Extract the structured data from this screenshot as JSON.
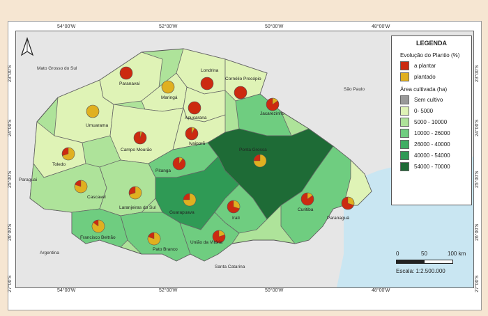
{
  "colors": {
    "a_plantar": "#cc2a10",
    "plantado": "#e0b020",
    "sem_cultivo": "#999999",
    "c0": "#dff3b6",
    "c1": "#aee39a",
    "c2": "#6fcd80",
    "c3": "#3fae63",
    "c4": "#2f9a55",
    "c5": "#1e6b36",
    "ocean": "#c9e6f2",
    "neighbor": "#e3e3e3"
  },
  "coords": {
    "top": [
      "54°00'W",
      "52°00'W",
      "50°00'W",
      "48°00'W"
    ],
    "bottom": [
      "54°00'W",
      "52°00'W",
      "50°00'W",
      "48°00'W"
    ],
    "left": [
      "23°00'S",
      "24°00'S",
      "25°00'S",
      "26°00'S",
      "27°00'S"
    ],
    "right": [
      "23°00'S",
      "24°00'S",
      "25°00'S",
      "26°00'S",
      "27°00'S"
    ]
  },
  "neighbors": {
    "mato_grosso_do_sul": "Mato Grosso do Sul",
    "sao_paulo": "São Paulo",
    "paraguai": "Paraguai",
    "argentina": "Argentina",
    "santa_catarina": "Santa Catarina"
  },
  "regions": [
    {
      "name": "Paranavaí",
      "pie": 0.0
    },
    {
      "name": "Maringá",
      "pie": 1.0
    },
    {
      "name": "Londrina",
      "pie": 0.0
    },
    {
      "name": "Cornélio Procópio",
      "pie": 0.0
    },
    {
      "name": "Umuarama",
      "pie": 1.0
    },
    {
      "name": "Apucarana",
      "pie": 0.0
    },
    {
      "name": "Jacarezinho",
      "pie": 0.15
    },
    {
      "name": "Campo Mourão",
      "pie": 0.05
    },
    {
      "name": "Ivaiporã",
      "pie": 0.08
    },
    {
      "name": "Toledo",
      "pie": 0.7
    },
    {
      "name": "Pitanga",
      "pie": 0.1
    },
    {
      "name": "Ponta Grossa",
      "pie": 0.75
    },
    {
      "name": "Cascavel",
      "pie": 0.8
    },
    {
      "name": "Laranjeiras do Sul",
      "pie": 0.7
    },
    {
      "name": "Guarapuava",
      "pie": 0.75
    },
    {
      "name": "Irati",
      "pie": 0.3
    },
    {
      "name": "Curitiba",
      "pie": 0.15
    },
    {
      "name": "Paranaguá",
      "pie": 0.3
    },
    {
      "name": "Francisco Beltrão",
      "pie": 0.85
    },
    {
      "name": "Pato Branco",
      "pie": 0.8
    },
    {
      "name": "União da Vitória",
      "pie": 0.2
    }
  ],
  "legend": {
    "title": "LEGENDA",
    "evolution_title": "Evolução do Plantio (%)",
    "a_plantar": "a plantar",
    "plantado": "plantado",
    "area_title": "Área cultivada (ha)",
    "classes": [
      "Sem cultivo",
      "0- 5000",
      "5000 - 10000",
      "10000 - 26000",
      "26000 - 40000",
      "40000 - 54000",
      "54000 - 70000"
    ]
  },
  "scale": {
    "ticks": [
      "0",
      "50",
      "100 km"
    ],
    "text": "Escala: 1:2.500.000"
  }
}
